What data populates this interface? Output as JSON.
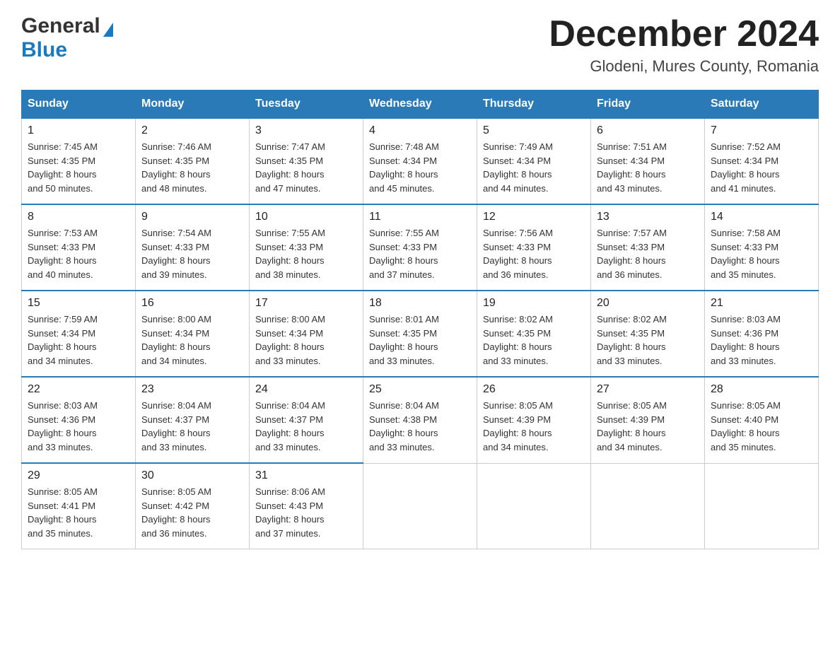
{
  "header": {
    "logo_general": "General",
    "logo_blue": "Blue",
    "month_title": "December 2024",
    "location": "Glodeni, Mures County, Romania"
  },
  "days_of_week": [
    "Sunday",
    "Monday",
    "Tuesday",
    "Wednesday",
    "Thursday",
    "Friday",
    "Saturday"
  ],
  "weeks": [
    [
      {
        "day": "1",
        "sunrise": "7:45 AM",
        "sunset": "4:35 PM",
        "daylight": "8 hours and 50 minutes."
      },
      {
        "day": "2",
        "sunrise": "7:46 AM",
        "sunset": "4:35 PM",
        "daylight": "8 hours and 48 minutes."
      },
      {
        "day": "3",
        "sunrise": "7:47 AM",
        "sunset": "4:35 PM",
        "daylight": "8 hours and 47 minutes."
      },
      {
        "day": "4",
        "sunrise": "7:48 AM",
        "sunset": "4:34 PM",
        "daylight": "8 hours and 45 minutes."
      },
      {
        "day": "5",
        "sunrise": "7:49 AM",
        "sunset": "4:34 PM",
        "daylight": "8 hours and 44 minutes."
      },
      {
        "day": "6",
        "sunrise": "7:51 AM",
        "sunset": "4:34 PM",
        "daylight": "8 hours and 43 minutes."
      },
      {
        "day": "7",
        "sunrise": "7:52 AM",
        "sunset": "4:34 PM",
        "daylight": "8 hours and 41 minutes."
      }
    ],
    [
      {
        "day": "8",
        "sunrise": "7:53 AM",
        "sunset": "4:33 PM",
        "daylight": "8 hours and 40 minutes."
      },
      {
        "day": "9",
        "sunrise": "7:54 AM",
        "sunset": "4:33 PM",
        "daylight": "8 hours and 39 minutes."
      },
      {
        "day": "10",
        "sunrise": "7:55 AM",
        "sunset": "4:33 PM",
        "daylight": "8 hours and 38 minutes."
      },
      {
        "day": "11",
        "sunrise": "7:55 AM",
        "sunset": "4:33 PM",
        "daylight": "8 hours and 37 minutes."
      },
      {
        "day": "12",
        "sunrise": "7:56 AM",
        "sunset": "4:33 PM",
        "daylight": "8 hours and 36 minutes."
      },
      {
        "day": "13",
        "sunrise": "7:57 AM",
        "sunset": "4:33 PM",
        "daylight": "8 hours and 36 minutes."
      },
      {
        "day": "14",
        "sunrise": "7:58 AM",
        "sunset": "4:33 PM",
        "daylight": "8 hours and 35 minutes."
      }
    ],
    [
      {
        "day": "15",
        "sunrise": "7:59 AM",
        "sunset": "4:34 PM",
        "daylight": "8 hours and 34 minutes."
      },
      {
        "day": "16",
        "sunrise": "8:00 AM",
        "sunset": "4:34 PM",
        "daylight": "8 hours and 34 minutes."
      },
      {
        "day": "17",
        "sunrise": "8:00 AM",
        "sunset": "4:34 PM",
        "daylight": "8 hours and 33 minutes."
      },
      {
        "day": "18",
        "sunrise": "8:01 AM",
        "sunset": "4:35 PM",
        "daylight": "8 hours and 33 minutes."
      },
      {
        "day": "19",
        "sunrise": "8:02 AM",
        "sunset": "4:35 PM",
        "daylight": "8 hours and 33 minutes."
      },
      {
        "day": "20",
        "sunrise": "8:02 AM",
        "sunset": "4:35 PM",
        "daylight": "8 hours and 33 minutes."
      },
      {
        "day": "21",
        "sunrise": "8:03 AM",
        "sunset": "4:36 PM",
        "daylight": "8 hours and 33 minutes."
      }
    ],
    [
      {
        "day": "22",
        "sunrise": "8:03 AM",
        "sunset": "4:36 PM",
        "daylight": "8 hours and 33 minutes."
      },
      {
        "day": "23",
        "sunrise": "8:04 AM",
        "sunset": "4:37 PM",
        "daylight": "8 hours and 33 minutes."
      },
      {
        "day": "24",
        "sunrise": "8:04 AM",
        "sunset": "4:37 PM",
        "daylight": "8 hours and 33 minutes."
      },
      {
        "day": "25",
        "sunrise": "8:04 AM",
        "sunset": "4:38 PM",
        "daylight": "8 hours and 33 minutes."
      },
      {
        "day": "26",
        "sunrise": "8:05 AM",
        "sunset": "4:39 PM",
        "daylight": "8 hours and 34 minutes."
      },
      {
        "day": "27",
        "sunrise": "8:05 AM",
        "sunset": "4:39 PM",
        "daylight": "8 hours and 34 minutes."
      },
      {
        "day": "28",
        "sunrise": "8:05 AM",
        "sunset": "4:40 PM",
        "daylight": "8 hours and 35 minutes."
      }
    ],
    [
      {
        "day": "29",
        "sunrise": "8:05 AM",
        "sunset": "4:41 PM",
        "daylight": "8 hours and 35 minutes."
      },
      {
        "day": "30",
        "sunrise": "8:05 AM",
        "sunset": "4:42 PM",
        "daylight": "8 hours and 36 minutes."
      },
      {
        "day": "31",
        "sunrise": "8:06 AM",
        "sunset": "4:43 PM",
        "daylight": "8 hours and 37 minutes."
      },
      null,
      null,
      null,
      null
    ]
  ],
  "labels": {
    "sunrise": "Sunrise: ",
    "sunset": "Sunset: ",
    "daylight": "Daylight: "
  }
}
